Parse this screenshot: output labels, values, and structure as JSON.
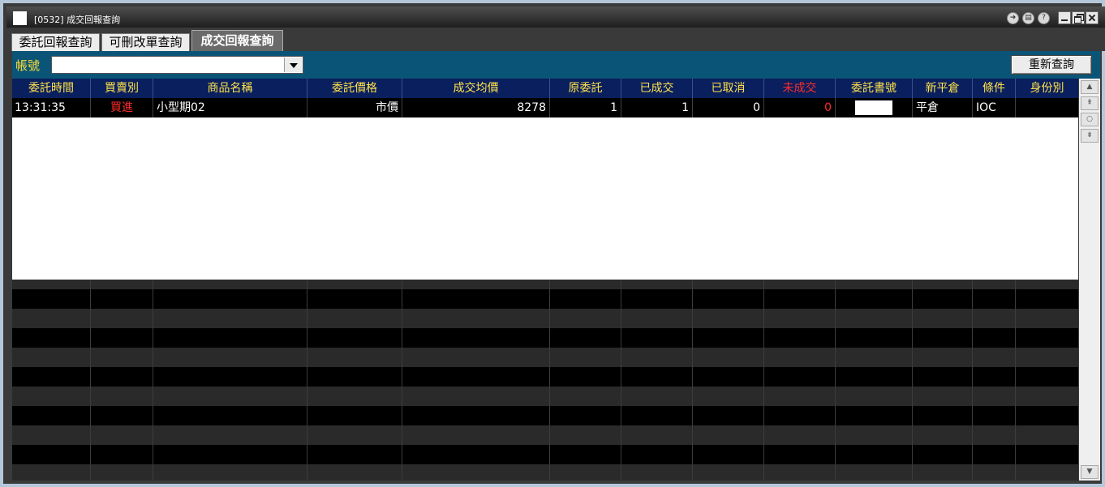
{
  "window": {
    "title": "[0532] 成交回報查詢",
    "titlebar_icons": [
      "share-icon",
      "print-icon",
      "help-icon"
    ],
    "window_buttons": [
      "minimize",
      "restore",
      "close"
    ]
  },
  "tabs": [
    {
      "label": "委託回報查詢",
      "active": false
    },
    {
      "label": "可刪改單查詢",
      "active": false
    },
    {
      "label": "成交回報查詢",
      "active": true
    }
  ],
  "query": {
    "account_label": "帳號",
    "account_value": "",
    "requery_label": "重新查詢"
  },
  "grid": {
    "columns": [
      "委託時間",
      "買賣別",
      "商品名稱",
      "委託價格",
      "成交均價",
      "原委託",
      "已成交",
      "已取消",
      "未成交",
      "委託書號",
      "新平倉",
      "條件",
      "身份別"
    ],
    "rows": [
      {
        "time": "13:31:35",
        "side": "買進",
        "product": "小型期02",
        "order_price": "市價",
        "avg_fill_price": "8278",
        "orig_qty": "1",
        "filled": "1",
        "cancelled": "0",
        "unfilled": "0",
        "order_no": "",
        "open_close": "平倉",
        "condition": "IOC",
        "identity": ""
      }
    ]
  },
  "colors": {
    "header_bg": "#0a1f5e",
    "header_text": "#ffe24a",
    "alert_red": "#ff2a2a",
    "query_bar_bg": "#0a5577"
  }
}
